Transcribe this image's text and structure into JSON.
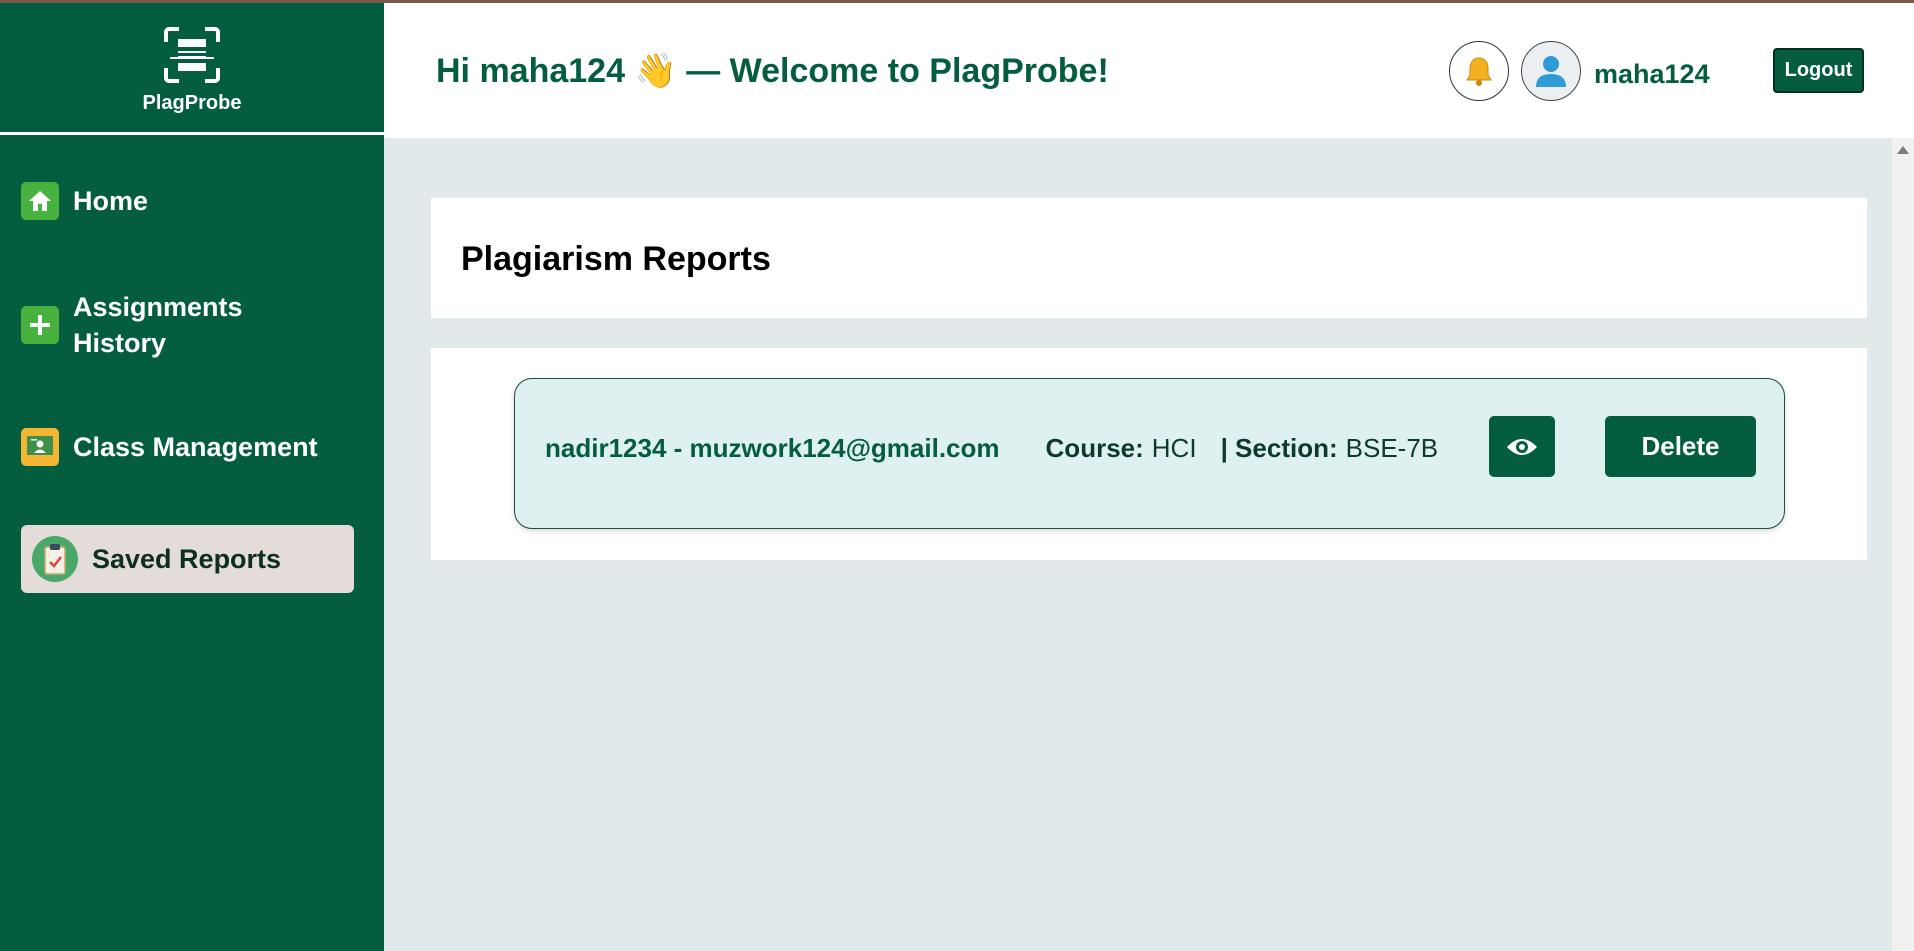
{
  "app": {
    "name": "PlagProbe"
  },
  "sidebar": {
    "items": [
      {
        "label": "Home",
        "icon": "home-icon"
      },
      {
        "label": "Assignments History",
        "icon": "plus-icon"
      },
      {
        "label": "Class Management",
        "icon": "classroom-icon"
      },
      {
        "label": "Saved Reports",
        "icon": "clipboard-check-icon",
        "active": true
      }
    ]
  },
  "header": {
    "greeting": "Hi maha124 👋 — Welcome to PlagProbe!",
    "username": "maha124",
    "logout_label": "Logout"
  },
  "main": {
    "title": "Plagiarism Reports",
    "reports": [
      {
        "user": "nadir1234 - muzwork124@gmail.com",
        "course_label": "Course:",
        "course": "HCI",
        "section_label": "| Section:",
        "section": "BSE-7B",
        "delete_label": "Delete"
      }
    ]
  },
  "colors": {
    "primary": "#035d3e",
    "accent_green": "#48b23f",
    "background": "#e2e9ea",
    "report_card": "#dff0f0",
    "active_nav": "#e3dcd9"
  }
}
